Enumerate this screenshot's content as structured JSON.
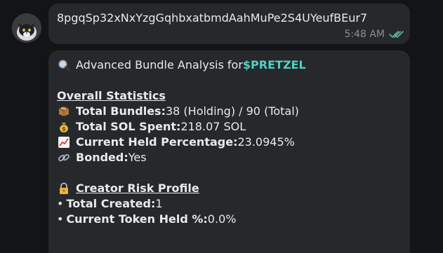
{
  "messages": {
    "incoming_1": {
      "text": "8pgqSp32xNxYzgGqhbxatbmdAahMuPe2S4UYeufBEur7",
      "time": "5:48 AM"
    },
    "incoming_2": {
      "header_prefix": "Advanced Bundle Analysis for ",
      "token": "$PRETZEL",
      "overall_title": "Overall Statistics",
      "stats": [
        {
          "icon": "package-icon",
          "label": "Total Bundles:",
          "value": " 38 (Holding) / 90 (Total)"
        },
        {
          "icon": "money-bag-icon",
          "label": "Total SOL Spent:",
          "value": " 218.07 SOL"
        },
        {
          "icon": "chart-increasing-icon",
          "label": "Current Held Percentage:",
          "value": " 23.0945%"
        },
        {
          "icon": "link-icon",
          "label": "Bonded:",
          "value": " Yes"
        }
      ],
      "creator_title": "Creator Risk Profile",
      "creator": [
        {
          "label": "Total Created:",
          "value": " 1"
        },
        {
          "label": "Current Token Held %:",
          "value": " 0.0%"
        }
      ],
      "bullet": "•"
    }
  },
  "colors": {
    "background": "#131415",
    "bubble": "#26282b",
    "accent": "#4fd1c5",
    "meta": "#8a8f97",
    "read_ticks": "#5fb7a6"
  },
  "icons": {
    "search": "search-icon",
    "creator": "locked-icon",
    "read_receipt": "double-check-icon"
  }
}
